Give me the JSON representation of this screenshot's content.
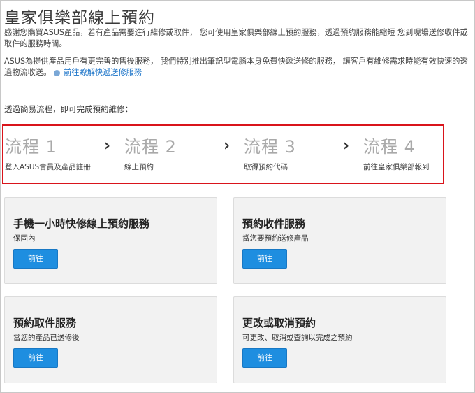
{
  "page": {
    "title": "皇家俱樂部線上預約",
    "intro_p1": "感謝您購買ASUS產品，若有產品需要進行維修或取件， 您可使用皇家俱樂部線上預約服務，透過預約服務能縮短 您到現場送修收件或取件的服務時間。",
    "intro_p2": "ASUS為提供產品用戶有更完善的售後服務， 我們特別推出筆記型電腦本身免費快遞送修的服務， 讓客戶有維修需求時能有效快速的透過物流收送。",
    "intro_p2_link": "前往瞭解快遞送修服務",
    "steps_intro": "透過簡易流程，即可完成預約維修："
  },
  "steps": [
    {
      "title": "流程 1",
      "desc": "登入ASUS會員及產品註冊"
    },
    {
      "title": "流程 2",
      "desc": "線上預約"
    },
    {
      "title": "流程 3",
      "desc": "取得預約代碼"
    },
    {
      "title": "流程 4",
      "desc": "前往皇家俱樂部報到"
    }
  ],
  "cards": [
    {
      "title": "手機一小時快修線上預約服務",
      "sub": "保固內",
      "button": "前往"
    },
    {
      "title": "預約收件服務",
      "sub": "當您要預約送修產品",
      "button": "前往"
    },
    {
      "title": "預約取件服務",
      "sub": "當您的產品已送修後",
      "button": "前往"
    },
    {
      "title": "更改或取消預約",
      "sub": "可更改、取消或查詢以完成之預約",
      "button": "前往"
    }
  ],
  "icons": {
    "info": "info-icon",
    "chevron": "chevron-right-icon"
  },
  "colors": {
    "accent": "#1e8ee0",
    "highlight_border": "#d9141b",
    "step_title": "#a9a9a9"
  }
}
